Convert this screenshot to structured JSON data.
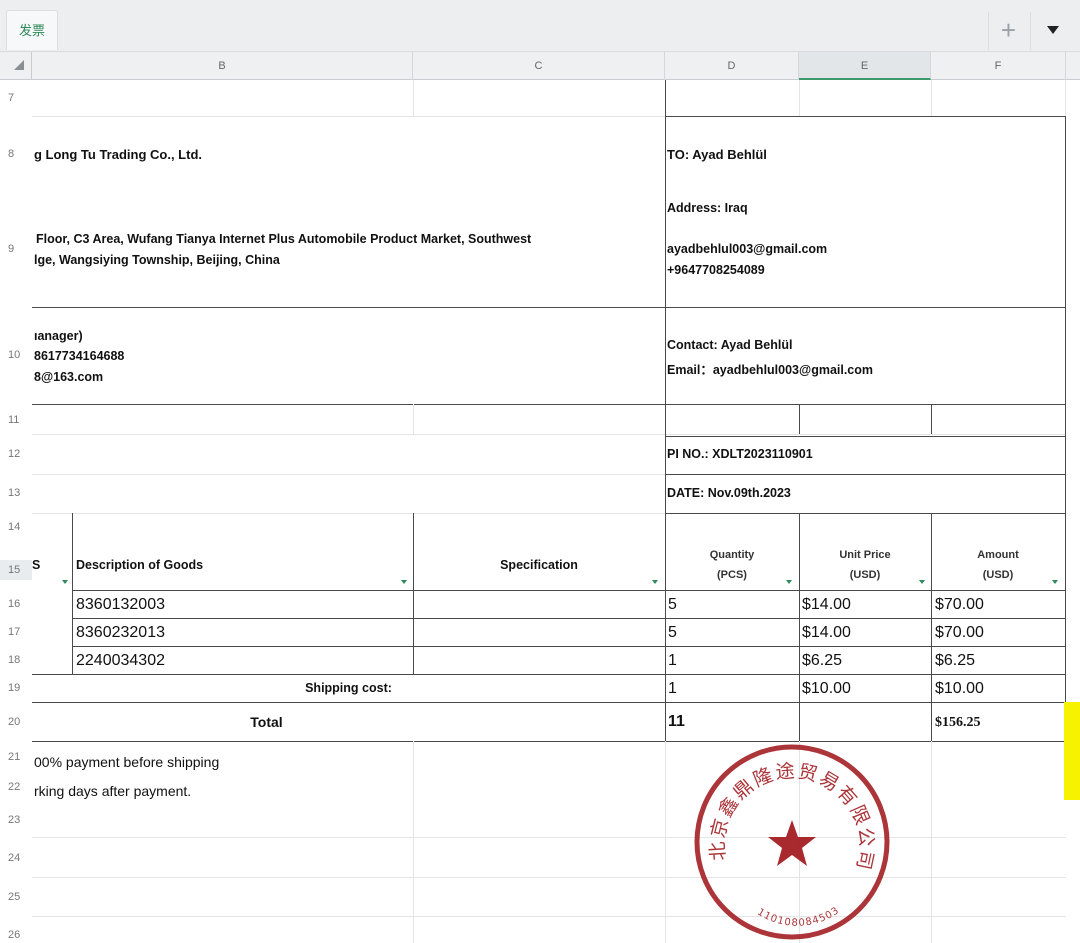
{
  "tabs": {
    "sheet_name": "发票",
    "add_icon": "plus-icon",
    "menu_icon": "caret-down-icon"
  },
  "columns": [
    "B",
    "C",
    "D",
    "E",
    "F"
  ],
  "rows": [
    "7",
    "8",
    "9",
    "10",
    "11",
    "12",
    "13",
    "14",
    "15",
    "16",
    "17",
    "18",
    "19",
    "20",
    "21",
    "22",
    "23",
    "24",
    "25",
    "26"
  ],
  "seller": {
    "name": "g Long Tu Trading Co., Ltd.",
    "address_line1": "Floor, C3 Area, Wufang Tianya Internet Plus Automobile Product Market, Southwest",
    "address_line2": "lge, Wangsiying Township, Beijing, China",
    "contact_line1": "ıanager)",
    "contact_line2": "8617734164688",
    "contact_line3": "8@163.com"
  },
  "buyer": {
    "to": "TO: Ayad Behlül",
    "address": "Address:  Iraq",
    "email": "ayadbehlul003@gmail.com",
    "phone": "+9647708254089",
    "contact": "Contact: Ayad Behlül",
    "contact_email": "Email：ayadbehlul003@gmail.com"
  },
  "pi_no": "PI NO.: XDLT2023110901",
  "date": "DATE: Nov.09th.2023",
  "table": {
    "headers": {
      "first_partial": "S",
      "description": "Description of Goods",
      "specification": "Specification",
      "quantity_line1": "Quantity",
      "quantity_line2": "(PCS)",
      "unit_price_line1": "Unit Price",
      "unit_price_line2": "(USD)",
      "amount_line1": "Amount",
      "amount_line2": "(USD)"
    },
    "items": [
      {
        "description": "8360132003",
        "quantity": "5",
        "unit_price": "$14.00",
        "amount": "$70.00"
      },
      {
        "description": "8360232013",
        "quantity": "5",
        "unit_price": "$14.00",
        "amount": "$70.00"
      },
      {
        "description": "2240034302",
        "quantity": "1",
        "unit_price": "$6.25",
        "amount": "$6.25"
      }
    ],
    "shipping": {
      "label": "Shipping cost:",
      "quantity": "1",
      "unit_price": "$10.00",
      "amount": "$10.00"
    },
    "total": {
      "label": "Total",
      "quantity": "11",
      "amount": "$156.25"
    }
  },
  "terms": {
    "line1": "00% payment before shipping",
    "line2": "rking days after payment."
  },
  "stamp": {
    "text": "北京鑫鼎隆途贸易有限公司",
    "number": "1101080845033",
    "color": "#a31f24"
  },
  "colors": {
    "highlight": "#f6f200",
    "accent": "#2f8a5a"
  }
}
